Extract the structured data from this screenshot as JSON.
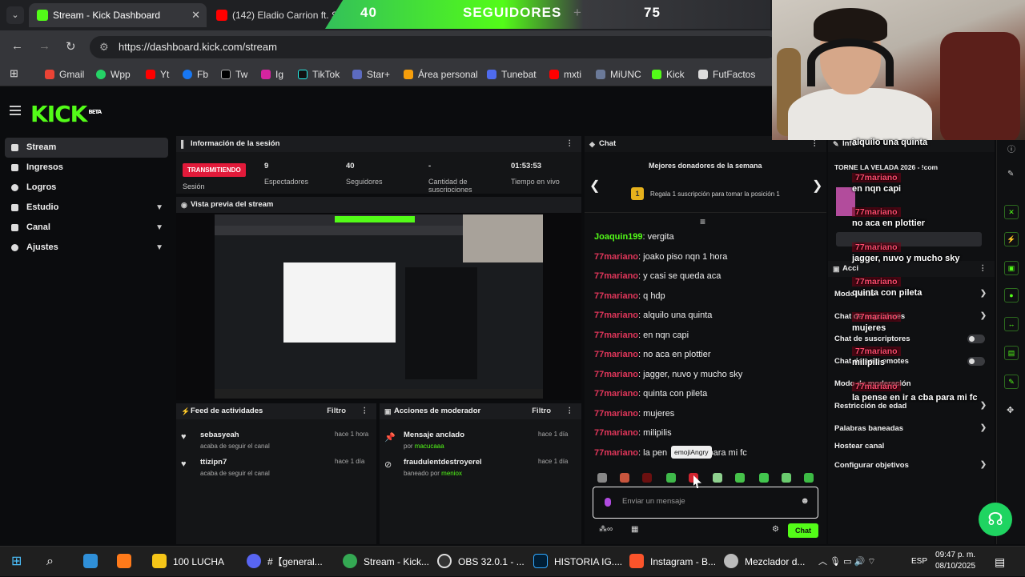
{
  "browser": {
    "tabs": [
      {
        "title": "Stream - Kick Dashboard",
        "active": true
      },
      {
        "title": "(142) Eladio Carrion ft. Sey",
        "active": false
      }
    ],
    "url": "https://dashboard.kick.com/stream",
    "bookmarks": [
      "Gmail",
      "Wpp",
      "Yt",
      "Fb",
      "Tw",
      "Ig",
      "TikTok",
      "Star+",
      "Área personal",
      "Tunebat",
      "mxti",
      "MiUNC",
      "Kick",
      "FutFactos"
    ]
  },
  "overlay_bar": {
    "left": "40",
    "label": "SEGUIDORES",
    "right": "75",
    "plus": "+"
  },
  "app": {
    "logo": "KICK",
    "beta": "BETA",
    "sidebar": [
      {
        "label": "Stream"
      },
      {
        "label": "Ingresos"
      },
      {
        "label": "Logros"
      },
      {
        "label": "Estudio"
      },
      {
        "label": "Canal"
      },
      {
        "label": "Ajustes"
      }
    ],
    "session": {
      "title": "Información de la sesión",
      "badge": "TRANSMITIENDO",
      "label": "Sesión",
      "stats": [
        {
          "value": "9",
          "label": "Espectadores"
        },
        {
          "value": "40",
          "label": "Seguidores"
        },
        {
          "value": "-",
          "label": "Cantidad de suscripciones"
        },
        {
          "value": "01:53:53",
          "label": "Tiempo en vivo"
        }
      ]
    },
    "preview_title": "Vista previa del stream",
    "feed": {
      "title": "Feed de actividades",
      "filter": "Filtro",
      "items": [
        {
          "user": "sebasyeah",
          "action": "acaba de seguir el canal",
          "time": "hace 1 hora"
        },
        {
          "user": "ttizipn7",
          "action": "acaba de seguir el canal",
          "time": "hace 1 día"
        }
      ]
    },
    "mod": {
      "title": "Acciones de moderador",
      "filter": "Filtro",
      "items": [
        {
          "title": "Mensaje anclado",
          "by": "por ",
          "user": "macucaaa",
          "time": "hace 1 día"
        },
        {
          "title": "fraudulentdestroyerel",
          "by": "baneado por ",
          "user": "meniox",
          "time": "hace 1 día"
        }
      ]
    },
    "chat": {
      "title": "Chat",
      "donors_title": "Mejores donadores de la semana",
      "donors_sub": "Regala 1 suscripción para tomar la posición 1",
      "rank": "1",
      "messages": [
        {
          "user": "Joaquin199",
          "text": ": vergita",
          "color": "g"
        },
        {
          "user": "77mariano",
          "text": ": joako piso nqn 1 hora",
          "color": "r"
        },
        {
          "user": "77mariano",
          "text": ": y casi se queda aca",
          "color": "r"
        },
        {
          "user": "77mariano",
          "text": ": q hdp",
          "color": "r"
        },
        {
          "user": "77mariano",
          "text": ": alquilo una quinta",
          "color": "r"
        },
        {
          "user": "77mariano",
          "text": ": en nqn capi",
          "color": "r"
        },
        {
          "user": "77mariano",
          "text": ": no aca en plottier",
          "color": "r"
        },
        {
          "user": "77mariano",
          "text": ": jagger, nuvo y mucho sky",
          "color": "r"
        },
        {
          "user": "77mariano",
          "text": ": quinta con pileta",
          "color": "r"
        },
        {
          "user": "77mariano",
          "text": ": mujeres",
          "color": "r"
        },
        {
          "user": "77mariano",
          "text": ": milipilis",
          "color": "r"
        },
        {
          "user": "77mariano",
          "text": ": la pen          cba para mi fc",
          "color": "r"
        }
      ],
      "tooltip": "emojiAngry",
      "placeholder": "Enviar un mensaje",
      "send": "Chat"
    },
    "right_panel": {
      "title": "Info",
      "stream_title": "TORNE          LA VELADA 2026 - !com",
      "actions_title": "Acci",
      "items": [
        "Modo lento",
        "Chat de seguidores",
        "Chat de suscriptores",
        "Chat de solo emotes",
        "Modo de moderación",
        "Restricción de edad",
        "Palabras baneadas",
        "Hostear canal",
        "Configurar objetivos"
      ]
    },
    "overlay_chat": [
      {
        "user": "",
        "text": "alquilo una quinta"
      },
      {
        "user": "77mariano",
        "text": "en nqn capi"
      },
      {
        "user": "77mariano",
        "text": "no aca en plottier"
      },
      {
        "user": "77mariano",
        "text": "jagger, nuvo y mucho sky"
      },
      {
        "user": "77mariano",
        "text": "quinta con pileta"
      },
      {
        "user": "77mariano",
        "text": "mujeres"
      },
      {
        "user": "77mariano",
        "text": "milipilis"
      },
      {
        "user": "77mariano",
        "text": "la pense en ir a cba para mi fc"
      }
    ]
  },
  "taskbar": {
    "items": [
      "100 LUCHA",
      "#【general...",
      "Stream - Kick...",
      "OBS 32.0.1 - ...",
      "HISTORIA IG....",
      "Instagram - B...",
      "Mezclador d..."
    ],
    "lang": "ESP",
    "time": "09:47 p. m.",
    "date": "08/10/2025"
  }
}
